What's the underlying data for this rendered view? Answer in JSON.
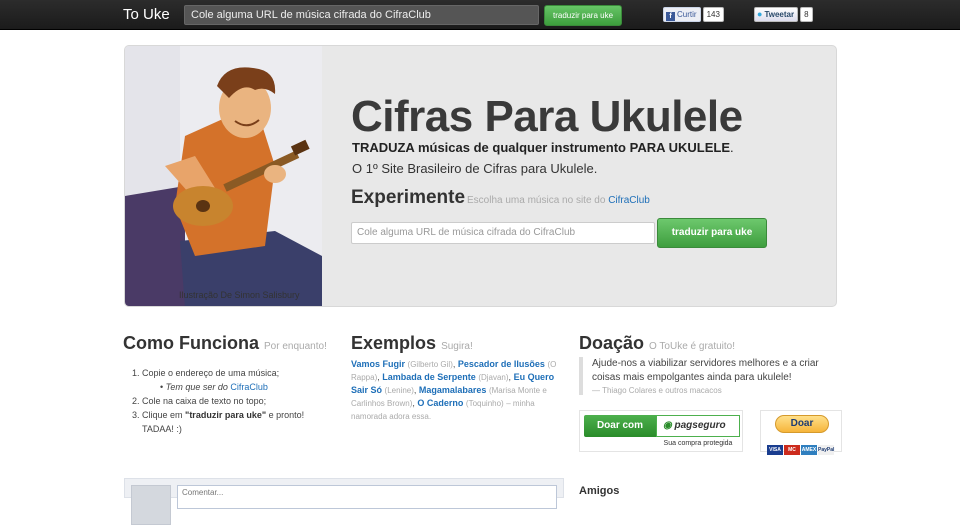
{
  "topbar": {
    "brand": "To Uke",
    "search_placeholder": "Cole alguma URL de música cifrada do CifraClub",
    "translate_button": "traduzir para uke",
    "facebook": {
      "icon": "f",
      "label": "Curtir",
      "count": "143"
    },
    "twitter": {
      "label": "Tweetar",
      "count": "8"
    }
  },
  "hero": {
    "title": "Cifras Para Ukulele",
    "subtitle_bold": "TRADUZA músicas de qualquer instrumento PARA UKULELE",
    "subtitle_end": ".",
    "tagline": "O 1º Site Brasileiro de Cifras para Ukulele.",
    "try_label": "Experimente",
    "try_hint": "Escolha uma música no site do",
    "try_hint_link": "CifraClub",
    "input_placeholder": "Cole alguma URL de música cifrada do CifraClub",
    "translate_button": "traduzir para uke",
    "illustration_credit": "Ilustração De Simon Salisbury"
  },
  "how": {
    "title": "Como Funciona",
    "aside": "Por enquanto!",
    "step1": "Copie o endereço de uma música;",
    "step1_sub": "Tem que ser do",
    "step1_sub_link": "CifraClub",
    "step2": "Cole na caixa de texto no topo;",
    "step3_pre": "Clique em",
    "step3_bold": "\"traduzir para uke\"",
    "step3_post": "e pronto!",
    "step3_end": "TADAA! :)"
  },
  "examples": {
    "title": "Exemplos",
    "aside": "Sugira!",
    "items": [
      {
        "song": "Vamos Fugir",
        "artist": "(Gilberto Gil)"
      },
      {
        "song": "Pescador de Ilusões",
        "artist": "(O Rappa)"
      },
      {
        "song": "Lambada de Serpente",
        "artist": "(Djavan)"
      },
      {
        "song": "Eu Quero Sair Só",
        "artist": "(Lenine)"
      },
      {
        "song": "Magamalabares",
        "artist": "(Marisa Monte e Carlinhos Brown)"
      },
      {
        "song": "O Caderno",
        "artist": "(Toquinho)"
      }
    ],
    "note": "– minha namorada adora essa."
  },
  "donation": {
    "title": "Doação",
    "aside": "O ToUke é gratuito!",
    "quote": "Ajude-nos a viabilizar servidores melhores e a criar coisas mais empolgantes ainda para ukulele!",
    "quote_by": "— Thiago Colares e outros macacos",
    "pagseguro_button": "Doar com",
    "pagseguro_brand": "pagseguro",
    "pagseguro_caption": "Sua compra protegida",
    "paypal_button": "Doar",
    "cards": [
      "VISA",
      "MC",
      "AMEX",
      "PayPal"
    ]
  },
  "comments": {
    "placeholder": "Comentar..."
  },
  "friends": {
    "title": "Amigos"
  },
  "colors": {
    "accent_green": "#4caf4c",
    "link_blue": "#1e6fb8",
    "topbar": "#222222"
  }
}
